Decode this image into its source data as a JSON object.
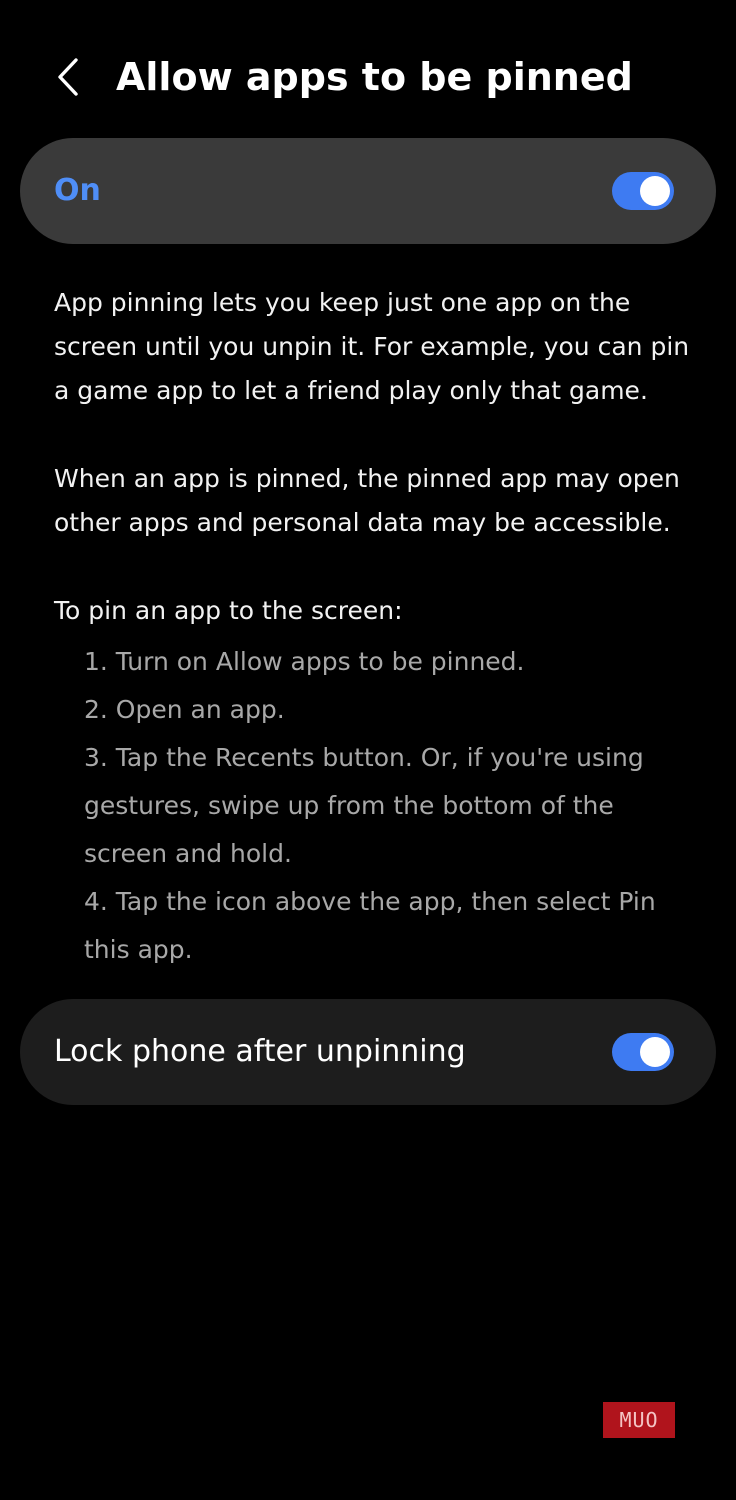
{
  "header": {
    "title": "Allow apps to be pinned",
    "back_icon": "chevron-left-icon"
  },
  "master_toggle": {
    "label": "On",
    "state": "on",
    "accent_color": "#4f8ef7"
  },
  "description": {
    "paragraph1": "App pinning lets you keep just one app on the screen until you unpin it. For example, you can pin a game app to let a friend play only that game.",
    "paragraph2": "When an app is pinned, the pinned app may open other apps and personal data may be accessible.",
    "steps_heading": "To pin an app to the screen:",
    "steps": [
      "1. Turn on Allow apps to be pinned.",
      "2. Open an app.",
      "3. Tap the Recents button. Or, if you're using gestures, swipe up from the bottom of the screen and hold.",
      "4. Tap the icon above the app, then select Pin this app."
    ]
  },
  "lock_toggle": {
    "label": "Lock phone after unpinning",
    "state": "on"
  },
  "watermark": {
    "text": "MUO"
  },
  "colors": {
    "background": "#000000",
    "card_highlight": "#3a3a3a",
    "card": "#1d1d1d",
    "toggle_on": "#3e7bf2",
    "secondary_text": "#a8a8a8"
  }
}
